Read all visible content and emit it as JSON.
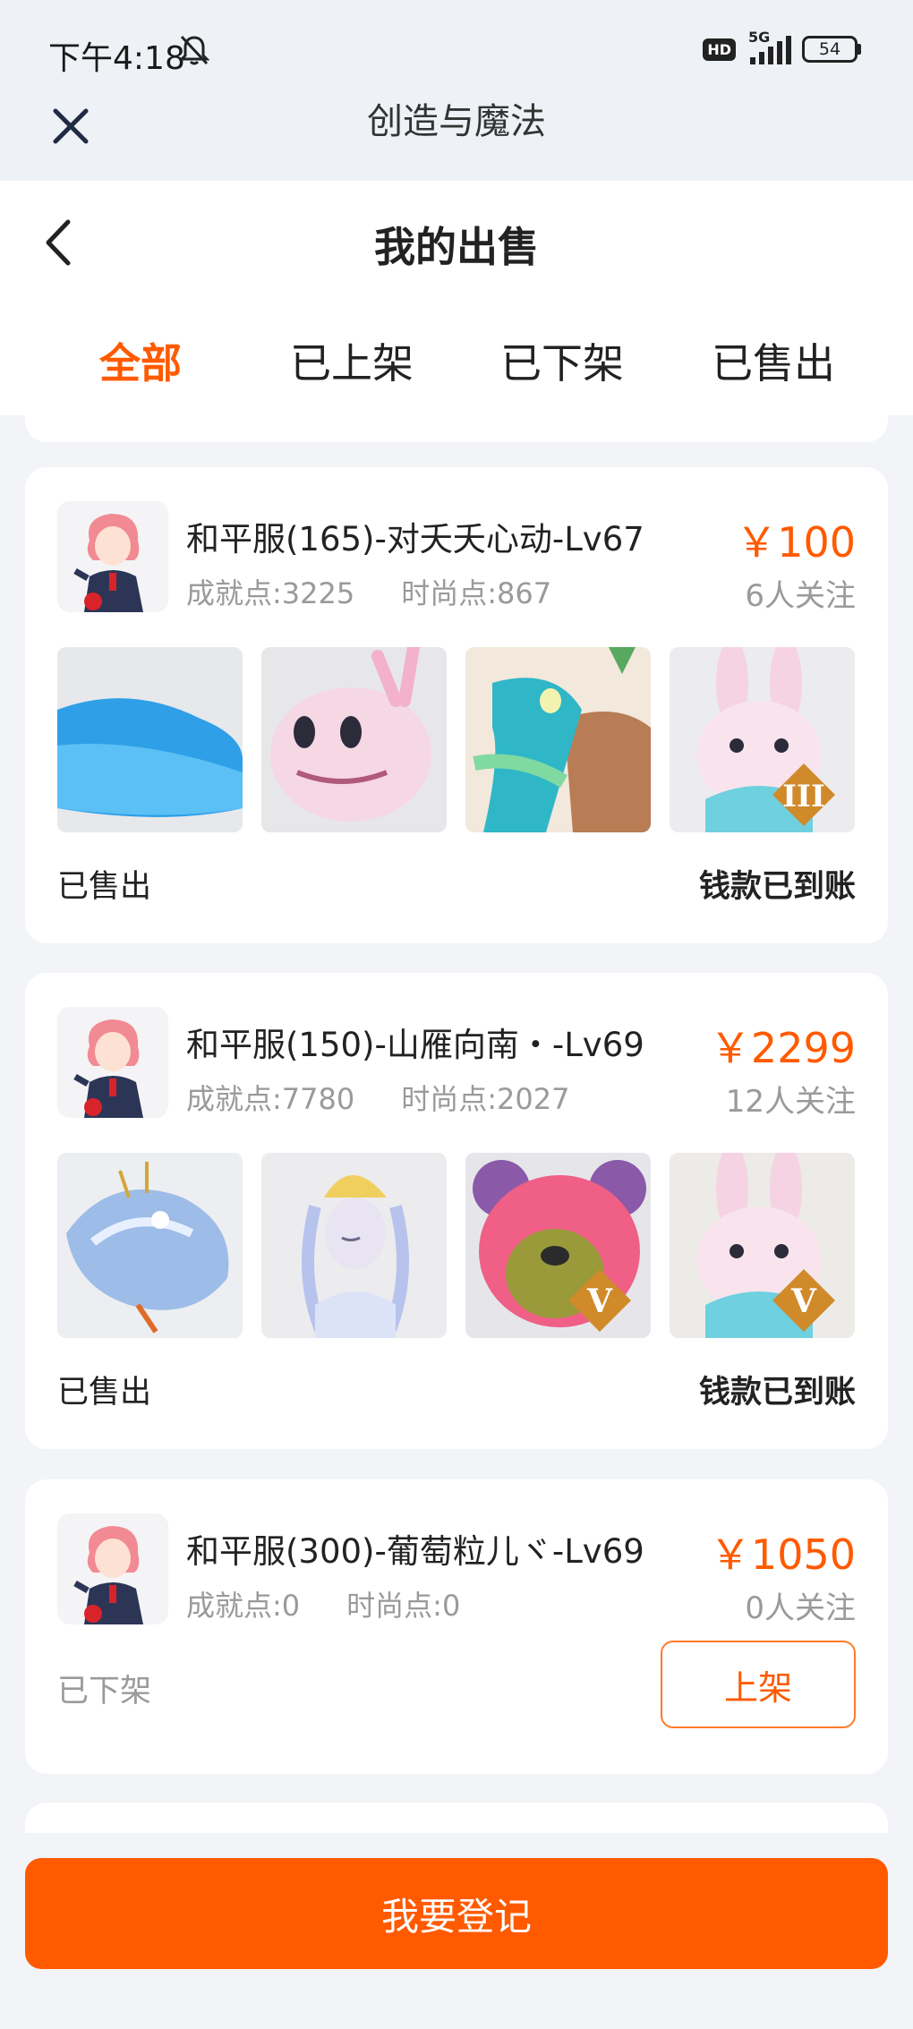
{
  "status_bar": {
    "time": "下午4:18",
    "hd": "HD",
    "network": "5G",
    "battery": "54"
  },
  "app_bar": {
    "title": "创造与魔法"
  },
  "page": {
    "title": "我的出售"
  },
  "tabs": [
    {
      "label": "全部",
      "active": true
    },
    {
      "label": "已上架",
      "active": false
    },
    {
      "label": "已下架",
      "active": false
    },
    {
      "label": "已售出",
      "active": false
    }
  ],
  "listings": [
    {
      "title": "和平服(165)-对夭夭心动-Lv67",
      "achievement": "成就点:3225",
      "fashion": "时尚点:867",
      "price": "￥100",
      "followers": "6人关注",
      "thumbnails": [
        "blue-whale-mount",
        "pink-axolotl-pet",
        "turtle-dragon-mount",
        "bunny-pet-tier-III"
      ],
      "status": "已售出",
      "payout": "钱款已到账"
    },
    {
      "title": "和平服(150)-山雁向南・-Lv69",
      "achievement": "成就点:7780",
      "fashion": "时尚点:2027",
      "price": "￥2299",
      "followers": "12人关注",
      "thumbnails": [
        "ice-dragon-mount",
        "celestial-fairy-outfit",
        "pink-bear-pet-tier-V",
        "bunny-pet-tier-V"
      ],
      "status": "已售出",
      "payout": "钱款已到账"
    },
    {
      "title": "和平服(300)-葡萄粒儿ヾ-Lv69",
      "achievement": "成就点:0",
      "fashion": "时尚点:0",
      "price": "￥1050",
      "followers": "0人关注",
      "status": "已下架",
      "action": "上架"
    }
  ],
  "footer": {
    "register_label": "我要登记"
  },
  "colors": {
    "accent": "#ff5a00",
    "muted_text": "#9a9a9a",
    "background": "#f2f4f7"
  }
}
